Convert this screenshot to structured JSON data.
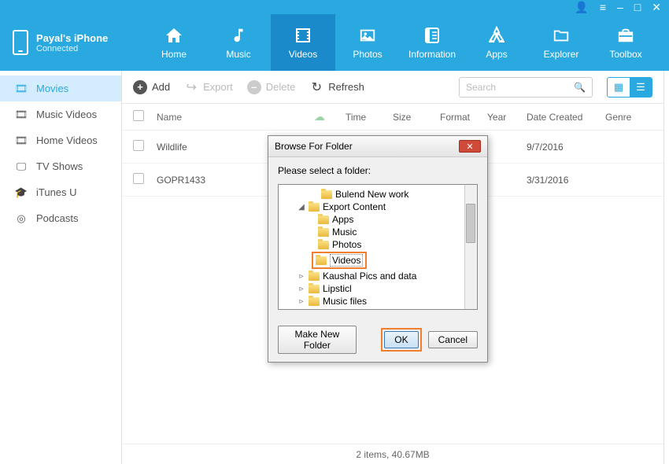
{
  "window_controls": {
    "user": "■",
    "settings": "≡",
    "min": "–",
    "max": "□",
    "close": "✕"
  },
  "device": {
    "name": "Payal's iPhone",
    "status": "Connected"
  },
  "nav": {
    "home": "Home",
    "music": "Music",
    "videos": "Videos",
    "photos": "Photos",
    "information": "Information",
    "apps": "Apps",
    "explorer": "Explorer",
    "toolbox": "Toolbox"
  },
  "sidebar": {
    "items": [
      {
        "label": "Movies"
      },
      {
        "label": "Music Videos"
      },
      {
        "label": "Home Videos"
      },
      {
        "label": "TV Shows"
      },
      {
        "label": "iTunes U"
      },
      {
        "label": "Podcasts"
      }
    ]
  },
  "toolbar": {
    "add": "Add",
    "export": "Export",
    "delete": "Delete",
    "refresh": "Refresh",
    "search_placeholder": "Search"
  },
  "columns": {
    "name": "Name",
    "time": "Time",
    "size": "Size",
    "format": "Format",
    "year": "Year",
    "date": "Date Created",
    "genre": "Genre"
  },
  "rows": [
    {
      "name": "Wildlife",
      "date": "9/7/2016"
    },
    {
      "name": "GOPR1433",
      "date": "3/31/2016"
    }
  ],
  "status": "2 items, 40.67MB",
  "dialog": {
    "title": "Browse For Folder",
    "prompt": "Please select a folder:",
    "tree": [
      {
        "indent": 2,
        "label": "Bulend New work",
        "arrow": ""
      },
      {
        "indent": 1,
        "label": "Export Content",
        "arrow": "◢"
      },
      {
        "indent": 2,
        "label": "Apps",
        "arrow": ""
      },
      {
        "indent": 2,
        "label": "Music",
        "arrow": ""
      },
      {
        "indent": 2,
        "label": "Photos",
        "arrow": ""
      },
      {
        "indent": 2,
        "label": "Videos",
        "arrow": "",
        "highlight": true
      },
      {
        "indent": 1,
        "label": "Kaushal Pics and data",
        "arrow": "▹"
      },
      {
        "indent": 1,
        "label": "Lipsticl",
        "arrow": "▹"
      },
      {
        "indent": 1,
        "label": "Music files",
        "arrow": "▹"
      }
    ],
    "make_new": "Make New Folder",
    "ok": "OK",
    "cancel": "Cancel"
  }
}
